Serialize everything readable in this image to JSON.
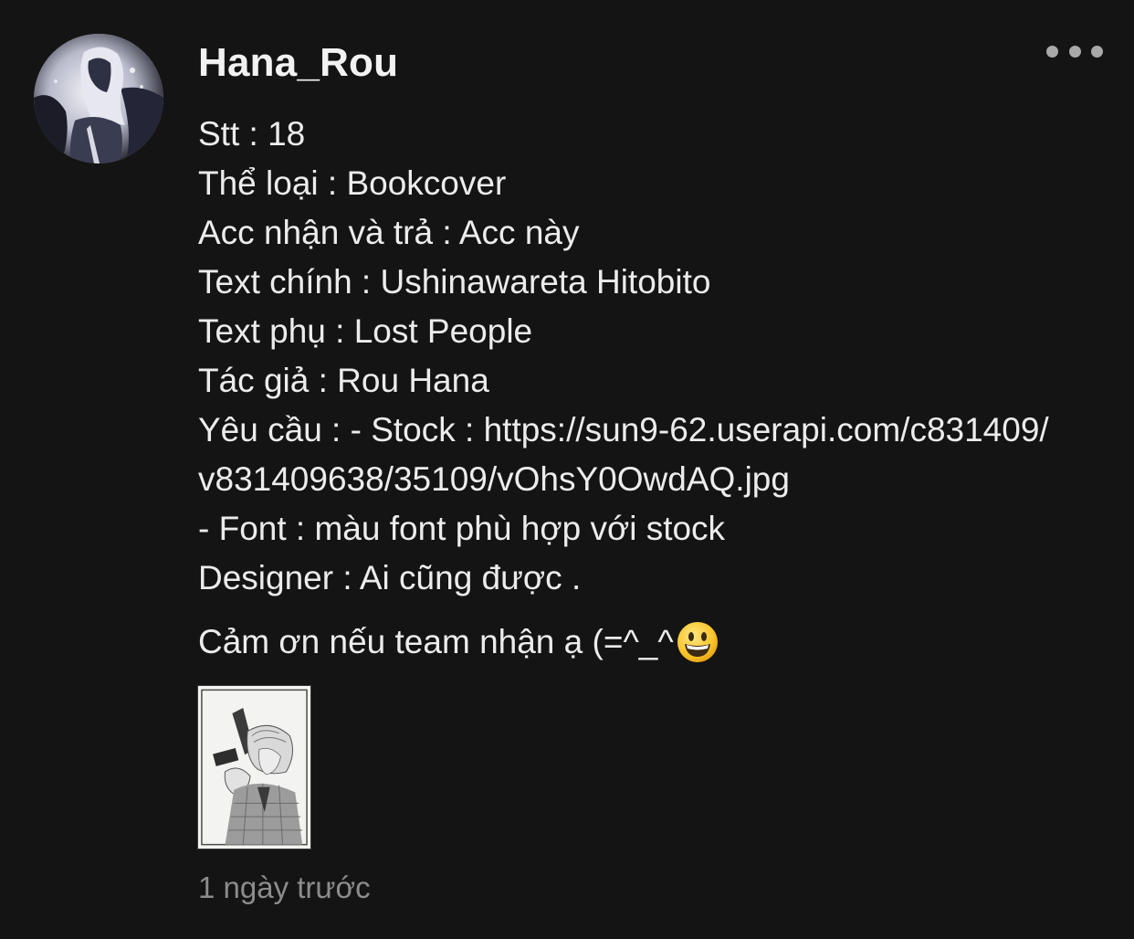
{
  "post": {
    "username": "Hana_Rou",
    "more_icon": "more-horizontal-icon",
    "lines": [
      "Stt : 18",
      "Thể loại : Bookcover",
      "Acc nhận và trả : Acc này",
      "Text chính : Ushinawareta Hitobito",
      "Text phụ : Lost People",
      "Tác giả : Rou Hana",
      "Yêu cầu :  - Stock : https://sun9-62.userapi.com/c831409/",
      "v831409638/35109/vOhsY0OwdAQ.jpg",
      "- Font : màu font phù hợp với stock",
      "Designer : Ai cũng được ."
    ],
    "thanks": "Cảm ơn nếu team nhận ạ (=^_^",
    "thanks_emoji": "grinning-face-emoji",
    "timestamp": "1 ngày trước"
  },
  "colors": {
    "background": "#141414",
    "text": "#ececec",
    "muted": "#8c8c8c"
  }
}
